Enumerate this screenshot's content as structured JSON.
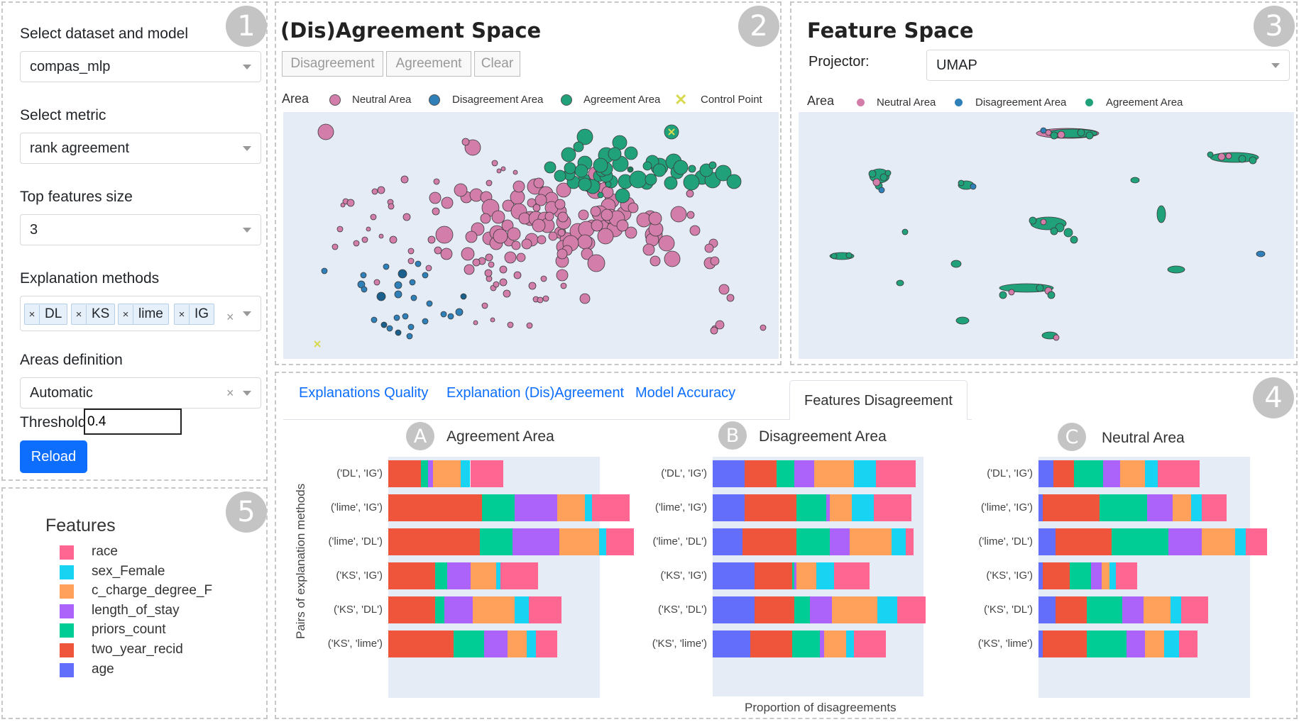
{
  "panel1": {
    "badge": "1",
    "dataset_label": "Select dataset and model",
    "dataset_value": "compas_mlp",
    "metric_label": "Select metric",
    "metric_value": "rank agreement",
    "topk_label": "Top features size",
    "topk_value": "3",
    "methods_label": "Explanation methods",
    "methods": [
      "DL",
      "KS",
      "lime",
      "IG"
    ],
    "areas_label": "Areas definition",
    "areas_value": "Automatic",
    "threshold_label": "Threshold",
    "threshold_value": "0.4",
    "reload_label": "Reload"
  },
  "panel2": {
    "badge": "2",
    "title": "(Dis)Agreement Space",
    "buttons": [
      "Disagreement",
      "Agreement",
      "Clear"
    ],
    "legend_title": "Area",
    "legend": [
      "Neutral Area",
      "Disagreement Area",
      "Agreement Area",
      "Control Point"
    ]
  },
  "panel3": {
    "badge": "3",
    "title": "Feature Space",
    "projector_label": "Projector:",
    "projector_value": "UMAP",
    "legend_title": "Area",
    "legend": [
      "Neutral Area",
      "Disagreement Area",
      "Agreement Area"
    ]
  },
  "panel4": {
    "badge": "4",
    "tabs": [
      "Explanations Quality",
      "Explanation (Dis)Agreement",
      "Model Accuracy",
      "Features Disagreement"
    ],
    "active_tab": "Features Disagreement",
    "yaxis_title": "Pairs of explanation methods",
    "xaxis_title": "Proportion of disagreements"
  },
  "panel5": {
    "badge": "5",
    "title": "Features",
    "features": [
      {
        "name": "race",
        "color": "#FF6692"
      },
      {
        "name": "sex_Female",
        "color": "#19D3F3"
      },
      {
        "name": "c_charge_degree_F",
        "color": "#FFA15A"
      },
      {
        "name": "length_of_stay",
        "color": "#AB63FA"
      },
      {
        "name": "priors_count",
        "color": "#00CC96"
      },
      {
        "name": "two_year_recid",
        "color": "#EF553B"
      },
      {
        "name": "age",
        "color": "#636EFA"
      }
    ]
  },
  "colors": {
    "neutral": "#d37dab",
    "disagreement": "#2f7fb8",
    "agreement": "#21a179",
    "control": "#dde06a",
    "plot_bg": "#e5ecf6",
    "accent": "#0d6efd"
  },
  "chart_data": [
    {
      "type": "bar",
      "orientation": "horizontal",
      "stacked": true,
      "badge": "A",
      "title": "Agreement Area",
      "categories": [
        "('DL', 'IG')",
        "('lime', 'IG')",
        "('lime', 'DL')",
        "('KS', 'IG')",
        "('KS', 'DL')",
        "('KS', 'lime')"
      ],
      "series": [
        {
          "name": "age",
          "values": [
            0,
            0,
            0,
            0,
            0,
            0
          ]
        },
        {
          "name": "two_year_recid",
          "values": [
            0.14,
            0.4,
            0.39,
            0.2,
            0.2,
            0.28
          ]
        },
        {
          "name": "priors_count",
          "values": [
            0.03,
            0.14,
            0.14,
            0.05,
            0.04,
            0.13
          ]
        },
        {
          "name": "length_of_stay",
          "values": [
            0.02,
            0.18,
            0.2,
            0.1,
            0.12,
            0.1
          ]
        },
        {
          "name": "c_charge_degree_F",
          "values": [
            0.12,
            0.12,
            0.17,
            0.11,
            0.18,
            0.08
          ]
        },
        {
          "name": "sex_Female",
          "values": [
            0.04,
            0.03,
            0.03,
            0.02,
            0.06,
            0.04
          ]
        },
        {
          "name": "race",
          "values": [
            0.14,
            0.16,
            0.12,
            0.16,
            0.14,
            0.09
          ]
        }
      ]
    },
    {
      "type": "bar",
      "orientation": "horizontal",
      "stacked": true,
      "badge": "B",
      "title": "Disagreement Area",
      "categories": [
        "('DL', 'IG')",
        "('lime', 'IG')",
        "('lime', 'DL')",
        "('KS', 'IG')",
        "('KS', 'DL')",
        "('KS', 'lime')"
      ],
      "series": [
        {
          "name": "age",
          "values": [
            0.16,
            0.16,
            0.15,
            0.21,
            0.21,
            0.19
          ]
        },
        {
          "name": "two_year_recid",
          "values": [
            0.16,
            0.26,
            0.27,
            0.19,
            0.2,
            0.21
          ]
        },
        {
          "name": "priors_count",
          "values": [
            0.09,
            0.15,
            0.17,
            0.01,
            0.08,
            0.14
          ]
        },
        {
          "name": "length_of_stay",
          "values": [
            0.1,
            0.02,
            0.1,
            0.01,
            0.11,
            0.02
          ]
        },
        {
          "name": "c_charge_degree_F",
          "values": [
            0.2,
            0.11,
            0.21,
            0.1,
            0.23,
            0.11
          ]
        },
        {
          "name": "sex_Female",
          "values": [
            0.11,
            0.11,
            0.07,
            0.09,
            0.1,
            0.04
          ]
        },
        {
          "name": "race",
          "values": [
            0.2,
            0.19,
            0.04,
            0.18,
            0.14,
            0.16
          ]
        }
      ]
    },
    {
      "type": "bar",
      "orientation": "horizontal",
      "stacked": true,
      "badge": "C",
      "title": "Neutral Area",
      "categories": [
        "('DL', 'IG')",
        "('lime', 'IG')",
        "('lime', 'DL')",
        "('KS', 'IG')",
        "('KS', 'DL')",
        "('KS', 'lime')"
      ],
      "series": [
        {
          "name": "age",
          "values": [
            0.07,
            0.02,
            0.08,
            0.02,
            0.08,
            0.02
          ]
        },
        {
          "name": "two_year_recid",
          "values": [
            0.1,
            0.27,
            0.27,
            0.13,
            0.15,
            0.21
          ]
        },
        {
          "name": "priors_count",
          "values": [
            0.14,
            0.23,
            0.27,
            0.1,
            0.17,
            0.19
          ]
        },
        {
          "name": "length_of_stay",
          "values": [
            0.08,
            0.12,
            0.16,
            0.05,
            0.1,
            0.09
          ]
        },
        {
          "name": "c_charge_degree_F",
          "values": [
            0.12,
            0.09,
            0.16,
            0.04,
            0.13,
            0.09
          ]
        },
        {
          "name": "sex_Female",
          "values": [
            0.06,
            0.05,
            0.05,
            0.03,
            0.05,
            0.07
          ]
        },
        {
          "name": "race",
          "values": [
            0.2,
            0.12,
            0.1,
            0.1,
            0.13,
            0.09
          ]
        }
      ]
    }
  ]
}
